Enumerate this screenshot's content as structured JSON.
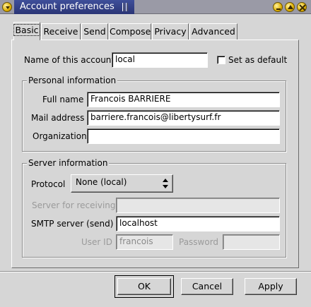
{
  "window": {
    "title": "Account preferences"
  },
  "tabs": [
    "Basic",
    "Receive",
    "Send",
    "Compose",
    "Privacy",
    "Advanced"
  ],
  "account": {
    "name_label": "Name of this account",
    "name_value": "local",
    "default_label": "Set as default"
  },
  "personal": {
    "title": "Personal information",
    "fullname_label": "Full name",
    "fullname_value": "Francois BARRIERE",
    "mail_label": "Mail address",
    "mail_value": "barriere.francois@libertysurf.fr",
    "org_label": "Organization",
    "org_value": ""
  },
  "server": {
    "title": "Server information",
    "protocol_label": "Protocol",
    "protocol_value": "None (local)",
    "receive_label": "Server for receiving",
    "receive_value": "",
    "smtp_label": "SMTP server (send)",
    "smtp_value": "localhost",
    "userid_label": "User ID",
    "userid_value": "francois",
    "password_label": "Password",
    "password_value": ""
  },
  "buttons": {
    "ok": "OK",
    "cancel": "Cancel",
    "apply": "Apply"
  },
  "icons": {
    "window_menu": "window-menu-icon",
    "minimize": "minimize-icon",
    "maximize": "maximize-icon",
    "close": "close-icon",
    "combo_arrows": "up-down-arrows-icon"
  },
  "colors": {
    "titlebar_active": "#2b3576",
    "window_bg": "#d6d6d6"
  }
}
